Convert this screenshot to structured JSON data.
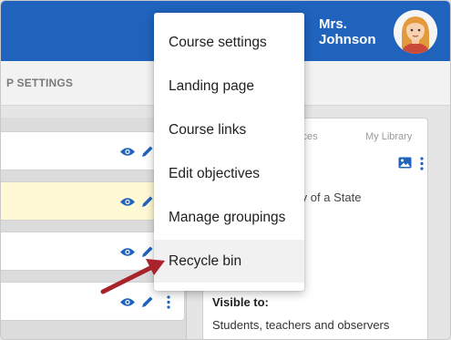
{
  "header": {
    "user_name_line1": "Mrs.",
    "user_name_line2": "Johnson",
    "brand_color": "#1f63bd"
  },
  "subnav": {
    "label": "P SETTINGS"
  },
  "rows": [
    {
      "highlighted": false
    },
    {
      "highlighted": true
    },
    {
      "highlighted": false
    },
    {
      "highlighted": false
    }
  ],
  "right_panel": {
    "tab_resources": "esources",
    "tab_library": "My Library",
    "description_fragment": "story of a State",
    "visible_to_label": "Visible to:",
    "visible_to_value": "Students, teachers and observers"
  },
  "menu": {
    "items": [
      {
        "label": "Course settings"
      },
      {
        "label": "Landing page"
      },
      {
        "label": "Course links"
      },
      {
        "label": "Edit objectives"
      },
      {
        "label": "Manage groupings"
      },
      {
        "label": "Recycle bin",
        "active": true
      }
    ]
  },
  "icons": {
    "eye": "eye-icon",
    "pencil": "pencil-icon",
    "kebab": "kebab-menu-icon",
    "image": "image-icon"
  },
  "annotation": {
    "arrow_color": "#a8232b"
  }
}
